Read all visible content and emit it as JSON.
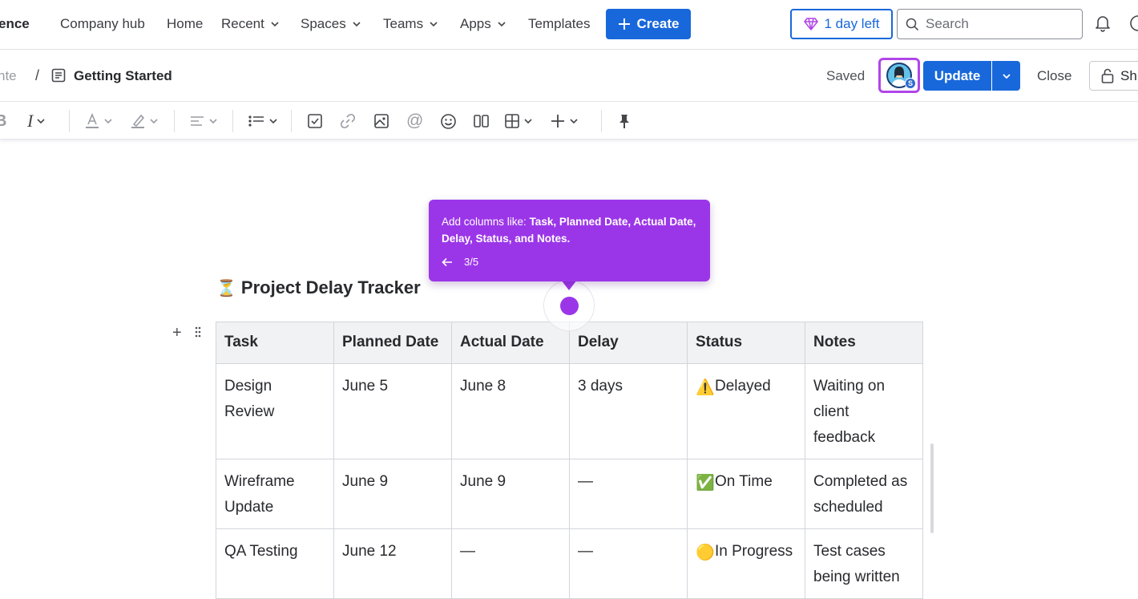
{
  "nav": {
    "brand": "ence",
    "items": [
      {
        "label": "Company hub",
        "dropdown": false
      },
      {
        "label": "Home",
        "dropdown": false
      },
      {
        "label": "Recent",
        "dropdown": true
      },
      {
        "label": "Spaces",
        "dropdown": true
      },
      {
        "label": "Teams",
        "dropdown": true
      },
      {
        "label": "Apps",
        "dropdown": true
      },
      {
        "label": "Templates",
        "dropdown": false
      }
    ],
    "create_label": "Create",
    "trial_label": "1 day left",
    "search_placeholder": "Search"
  },
  "pagebar": {
    "parent_crumb": "nte",
    "separator": "/",
    "title": "Getting Started",
    "saved_label": "Saved",
    "avatar_badge": "S",
    "update_label": "Update",
    "close_label": "Close",
    "share_label": "Sh"
  },
  "toolbar": {
    "tools": [
      "bold",
      "italic",
      "text-color",
      "highlight",
      "alignment",
      "bullet-list",
      "task",
      "link",
      "image",
      "mention",
      "emoji",
      "layout",
      "table",
      "insert",
      "pin"
    ]
  },
  "tooltip": {
    "text_prefix": "Add columns like: ",
    "text_bold": "Task, Planned Date, Actual Date, Delay, Status, and Notes.",
    "step": "3/5"
  },
  "content": {
    "title_emoji": "⏳",
    "title": "Project Delay Tracker",
    "table": {
      "headers": [
        "Task",
        "Planned Date",
        "Actual Date",
        "Delay",
        "Status",
        "Notes"
      ],
      "rows": [
        {
          "task": "Design Review",
          "planned": "June 5",
          "actual": "June 8",
          "delay": "3 days",
          "status_emoji": "⚠️",
          "status": "Delayed",
          "notes": "Waiting on client feedback"
        },
        {
          "task": "Wireframe Update",
          "planned": "June 9",
          "actual": "June 9",
          "delay": "—",
          "status_emoji": "✅",
          "status": "On Time",
          "notes": "Completed as scheduled"
        },
        {
          "task": "QA Testing",
          "planned": "June 12",
          "actual": "—",
          "delay": "—",
          "status_emoji": "🟡",
          "status": "In Progress",
          "notes": "Test cases being written"
        }
      ]
    }
  },
  "colors": {
    "accent": "#1868db",
    "tooltip": "#9b36e8",
    "header_bg": "#f1f2f4"
  }
}
